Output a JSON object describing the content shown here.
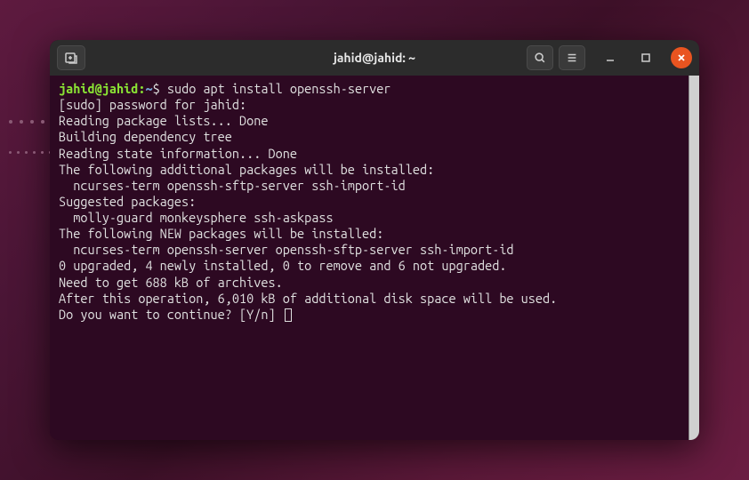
{
  "window": {
    "title": "jahid@jahid: ~"
  },
  "prompt": {
    "user_host": "jahid@jahid",
    "path": "~",
    "symbol": "$"
  },
  "command": "sudo apt install openssh-server",
  "output": {
    "l1": "[sudo] password for jahid:",
    "l2": "Reading package lists... Done",
    "l3": "Building dependency tree",
    "l4": "Reading state information... Done",
    "l5": "The following additional packages will be installed:",
    "l6": "  ncurses-term openssh-sftp-server ssh-import-id",
    "l7": "Suggested packages:",
    "l8": "  molly-guard monkeysphere ssh-askpass",
    "l9": "The following NEW packages will be installed:",
    "l10": "  ncurses-term openssh-server openssh-sftp-server ssh-import-id",
    "l11": "0 upgraded, 4 newly installed, 0 to remove and 6 not upgraded.",
    "l12": "Need to get 688 kB of archives.",
    "l13": "After this operation, 6,010 kB of additional disk space will be used.",
    "l14": "Do you want to continue? [Y/n] "
  }
}
